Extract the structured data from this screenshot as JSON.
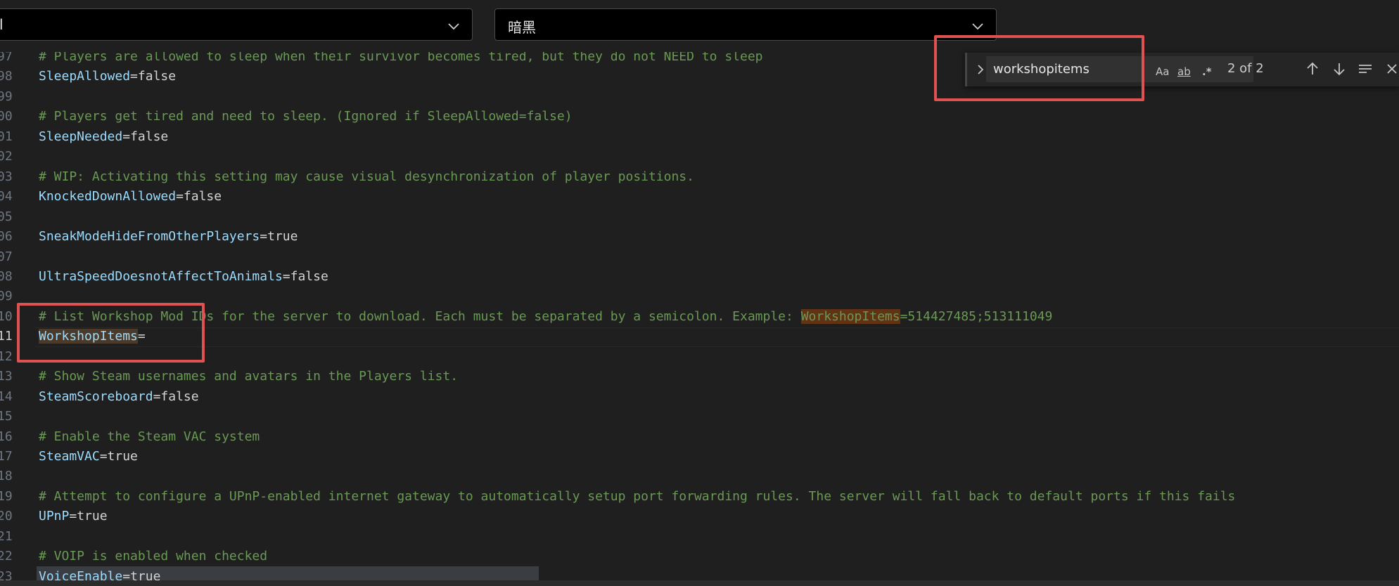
{
  "dropdowns": [
    {
      "value": "l"
    },
    {
      "value": "暗黑"
    }
  ],
  "find_widget": {
    "query": "workshopitems",
    "match_case_label": "Aa",
    "whole_word_label": "ab",
    "regex_label": ".*",
    "result_count": "2 of 2"
  },
  "editor": {
    "lines": [
      {
        "num": "97",
        "comment": "# Players are allowed to sleep when their survivor becomes tired, but they do not NEED to sleep"
      },
      {
        "num": "98",
        "key": "SleepAllowed",
        "value": "false"
      },
      {
        "num": "99"
      },
      {
        "num": "00",
        "comment": "# Players get tired and need to sleep. (Ignored if SleepAllowed=false)"
      },
      {
        "num": "01",
        "key": "SleepNeeded",
        "value": "false"
      },
      {
        "num": "02"
      },
      {
        "num": "03",
        "comment": "# WIP: Activating this setting may cause visual desynchronization of player positions."
      },
      {
        "num": "04",
        "key": "KnockedDownAllowed",
        "value": "false"
      },
      {
        "num": "05"
      },
      {
        "num": "06",
        "key": "SneakModeHideFromOtherPlayers",
        "value": "true"
      },
      {
        "num": "07"
      },
      {
        "num": "08",
        "key": "UltraSpeedDoesnotAffectToAnimals",
        "value": "false"
      },
      {
        "num": "09"
      },
      {
        "num": "10",
        "comment_pre": "# List Workshop Mod IDs for the server to download. Each must be separated by a semicolon. Example: ",
        "comment_match": "WorkshopItems",
        "comment_post": "=514427485;513111049"
      },
      {
        "num": "11",
        "key": "WorkshopItems",
        "value": ""
      },
      {
        "num": "12"
      },
      {
        "num": "13",
        "comment": "# Show Steam usernames and avatars in the Players list."
      },
      {
        "num": "14",
        "key": "SteamScoreboard",
        "value": "false"
      },
      {
        "num": "15"
      },
      {
        "num": "16",
        "comment": "# Enable the Steam VAC system"
      },
      {
        "num": "17",
        "key": "SteamVAC",
        "value": "true"
      },
      {
        "num": "18"
      },
      {
        "num": "19",
        "comment": "# Attempt to configure a UPnP-enabled internet gateway to automatically setup port forwarding rules. The server will fall back to default ports if this fails"
      },
      {
        "num": "20",
        "key": "UPnP",
        "value": "true"
      },
      {
        "num": "21"
      },
      {
        "num": "22",
        "comment": "# VOIP is enabled when checked"
      },
      {
        "num": "23",
        "key": "VoiceEnable",
        "value": "true"
      }
    ]
  }
}
